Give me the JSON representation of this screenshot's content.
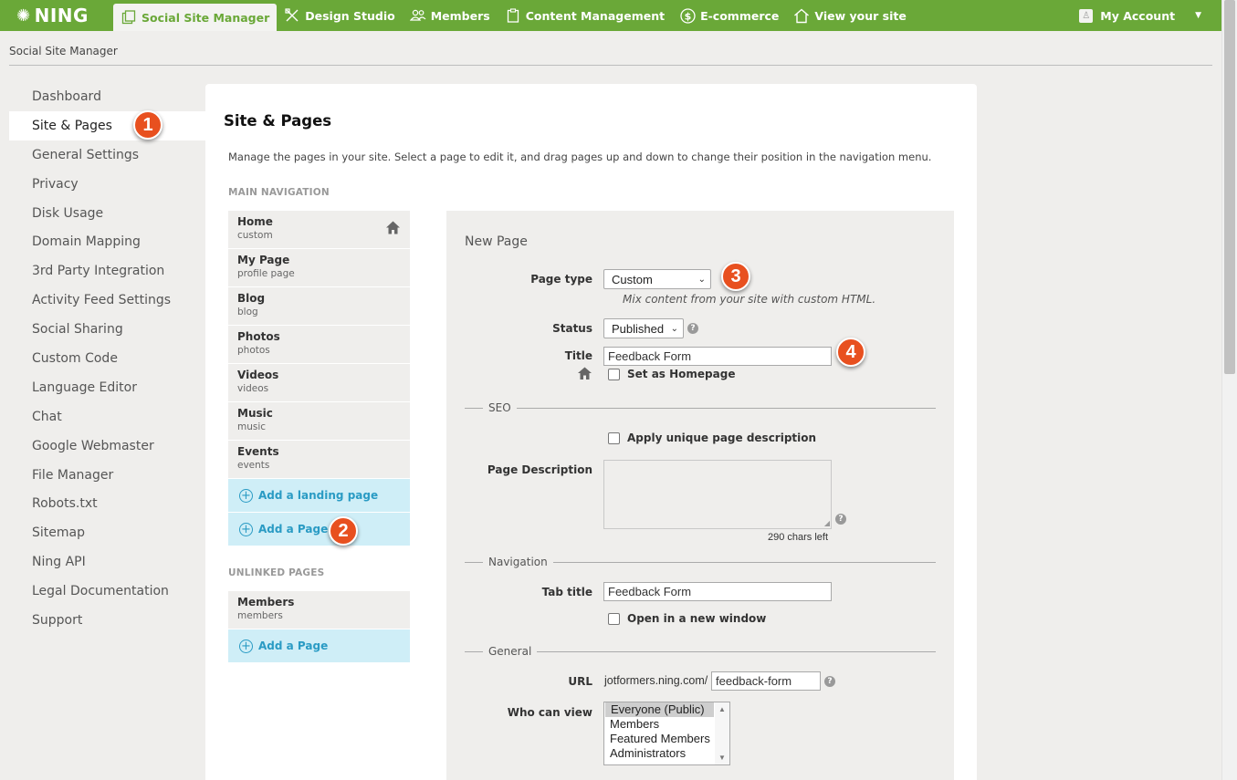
{
  "app": {
    "logo_text": "NING"
  },
  "topnav": {
    "items": [
      {
        "label": "Social Site Manager",
        "icon": "pages-icon"
      },
      {
        "label": "Design Studio",
        "icon": "design-icon"
      },
      {
        "label": "Members",
        "icon": "members-icon"
      },
      {
        "label": "Content Management",
        "icon": "clipboard-icon"
      },
      {
        "label": "E-commerce",
        "icon": "dollar-icon"
      },
      {
        "label": "View your site",
        "icon": "house-icon"
      }
    ],
    "account_label": "My Account"
  },
  "breadcrumb": "Social Site Manager",
  "sidebar": {
    "items": [
      {
        "label": "Dashboard"
      },
      {
        "label": "Site & Pages"
      },
      {
        "label": "General Settings"
      },
      {
        "label": "Privacy"
      },
      {
        "label": "Disk Usage"
      },
      {
        "label": "Domain Mapping"
      },
      {
        "label": "3rd Party Integration"
      },
      {
        "label": "Activity Feed Settings"
      },
      {
        "label": "Social Sharing"
      },
      {
        "label": "Custom Code"
      },
      {
        "label": "Language Editor"
      },
      {
        "label": "Chat"
      },
      {
        "label": "Google Webmaster"
      },
      {
        "label": "File Manager"
      },
      {
        "label": "Robots.txt"
      },
      {
        "label": "Sitemap"
      },
      {
        "label": "Ning API"
      },
      {
        "label": "Legal Documentation"
      },
      {
        "label": "Support"
      }
    ]
  },
  "badges": {
    "b1": "1",
    "b2": "2",
    "b3": "3",
    "b4": "4"
  },
  "main": {
    "title": "Site & Pages",
    "description": "Manage the pages in your site. Select a page to edit it, and drag pages up and down to change their position in the navigation menu.",
    "main_nav_label": "MAIN NAVIGATION",
    "main_pages": [
      {
        "name": "Home",
        "type": "custom"
      },
      {
        "name": "My Page",
        "type": "profile page"
      },
      {
        "name": "Blog",
        "type": "blog"
      },
      {
        "name": "Photos",
        "type": "photos"
      },
      {
        "name": "Videos",
        "type": "videos"
      },
      {
        "name": "Music",
        "type": "music"
      },
      {
        "name": "Events",
        "type": "events"
      }
    ],
    "add_landing_label": "Add a landing page",
    "add_page_label": "Add a Page",
    "unlinked_label": "UNLINKED PAGES",
    "unlinked_pages": [
      {
        "name": "Members",
        "type": "members"
      }
    ]
  },
  "form": {
    "title": "New Page",
    "page_type_label": "Page type",
    "page_type_value": "Custom",
    "page_type_hint": "Mix content from your site with custom HTML.",
    "status_label": "Status",
    "status_value": "Published",
    "title_label": "Title",
    "title_value": "Feedback Form",
    "homepage_label": "Set as Homepage",
    "seo_label": "SEO",
    "apply_desc_label": "Apply unique page description",
    "page_desc_label": "Page Description",
    "chars_left": "290 chars left",
    "navigation_label": "Navigation",
    "tab_title_label": "Tab title",
    "tab_title_value": "Feedback Form",
    "new_window_label": "Open in a new window",
    "general_label": "General",
    "url_label": "URL",
    "url_prefix": "jotformers.ning.com/",
    "url_value": "feedback-form",
    "who_view_label": "Who can view",
    "who_view_options": [
      "Everyone (Public)",
      "Members",
      "Featured Members",
      "Administrators"
    ],
    "help_glyph": "?"
  }
}
